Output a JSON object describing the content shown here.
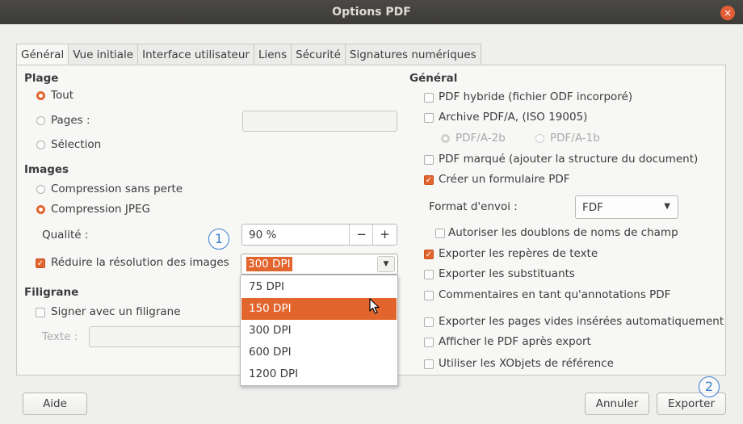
{
  "window": {
    "title": "Options PDF",
    "close_glyph": "×"
  },
  "tabs": [
    "Général",
    "Vue initiale",
    "Interface utilisateur",
    "Liens",
    "Sécurité",
    "Signatures numériques"
  ],
  "plage": {
    "heading": "Plage",
    "tout": "Tout",
    "pages": "Pages :",
    "selection": "Sélection",
    "selected": "Tout"
  },
  "images": {
    "heading": "Images",
    "lossless": "Compression sans perte",
    "jpeg": "Compression JPEG",
    "selected": "Compression JPEG",
    "quality_label": "Qualité :",
    "quality_value": "90 %",
    "minus": "−",
    "plus": "+",
    "reduce_label": "Réduire la résolution des images",
    "reduce_checked": true,
    "resolution_value": "300 DPI",
    "resolution_options": [
      "75 DPI",
      "150 DPI",
      "300 DPI",
      "600 DPI",
      "1200 DPI"
    ],
    "resolution_highlighted": "150 DPI"
  },
  "filigrane": {
    "heading": "Filigrane",
    "sign_label": "Signer avec un filigrane",
    "text_label": "Texte :"
  },
  "general": {
    "heading": "Général",
    "hybrid": "PDF hybride (fichier ODF incorporé)",
    "archive": "Archive PDF/A, (ISO 19005)",
    "pdfa2b": "PDF/A-2b",
    "pdfa1b": "PDF/A-1b",
    "tagged": "PDF marqué (ajouter la structure du document)",
    "create_form": "Créer un formulaire PDF",
    "submit_format_label": "Format d'envoi :",
    "submit_format_value": "FDF",
    "allow_duplicates": "Autoriser les doublons de noms de champ",
    "bookmarks": "Exporter les repères de texte",
    "placeholders": "Exporter les substituants",
    "comments": "Commentaires en tant qu'annotations PDF",
    "empty_pages": "Exporter les pages vides insérées automatiquement",
    "view_after": "Afficher le PDF après export",
    "xobjects": "Utiliser les XObjets de référence"
  },
  "buttons": {
    "help": "Aide",
    "cancel": "Annuler",
    "export": "Exporter"
  },
  "annotations": {
    "badge1": "1",
    "badge2": "2"
  },
  "colors": {
    "accent": "#e2652e",
    "titlebar": "#3c3b37",
    "badge": "#3b7fd0"
  }
}
